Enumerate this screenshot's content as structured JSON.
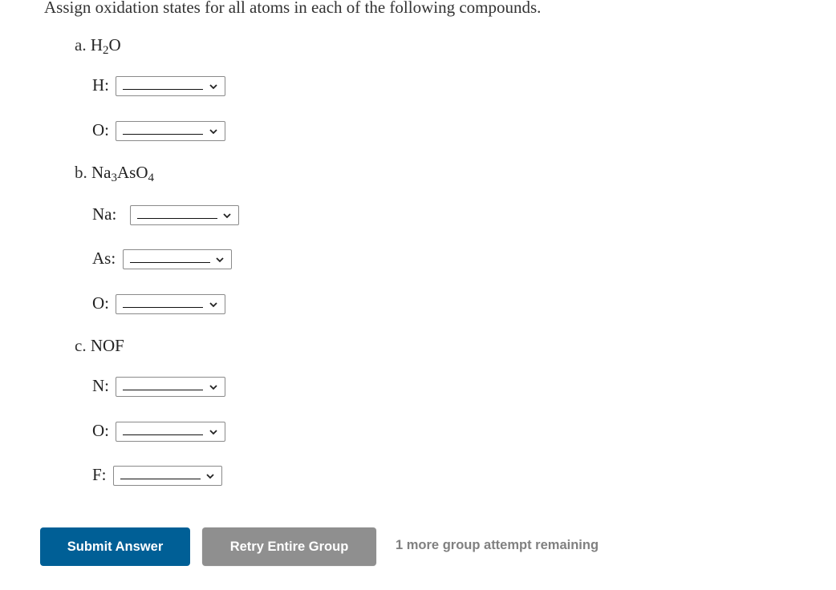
{
  "instructions": "Assign oxidation states for all atoms in each of the following compounds.",
  "parts": [
    {
      "letter": "a.",
      "formula_parts": [
        "H",
        "2",
        "O"
      ],
      "atoms": [
        {
          "label": "H:",
          "selected": "____________"
        },
        {
          "label": "O:",
          "selected": "____________"
        }
      ]
    },
    {
      "letter": "b.",
      "formula_parts": [
        "Na",
        "3",
        "AsO",
        "4"
      ],
      "atoms": [
        {
          "label": "Na:",
          "selected": "____________"
        },
        {
          "label": "As:",
          "selected": "____________"
        },
        {
          "label": "O:",
          "selected": "____________"
        }
      ]
    },
    {
      "letter": "c.",
      "formula_parts": [
        "NOF"
      ],
      "atoms": [
        {
          "label": "N:",
          "selected": "____________"
        },
        {
          "label": "O:",
          "selected": "____________"
        },
        {
          "label": "F:",
          "selected": "____________"
        }
      ]
    }
  ],
  "buttons": {
    "submit_label": "Submit Answer",
    "retry_label": "Retry Entire Group"
  },
  "attempts_text": "1 more group attempt remaining",
  "icons": {
    "select_chevron": "chevron-down-icon"
  },
  "colors": {
    "submit": "#005f96",
    "retry": "#8f8f8f",
    "attempts_text": "#808080"
  }
}
